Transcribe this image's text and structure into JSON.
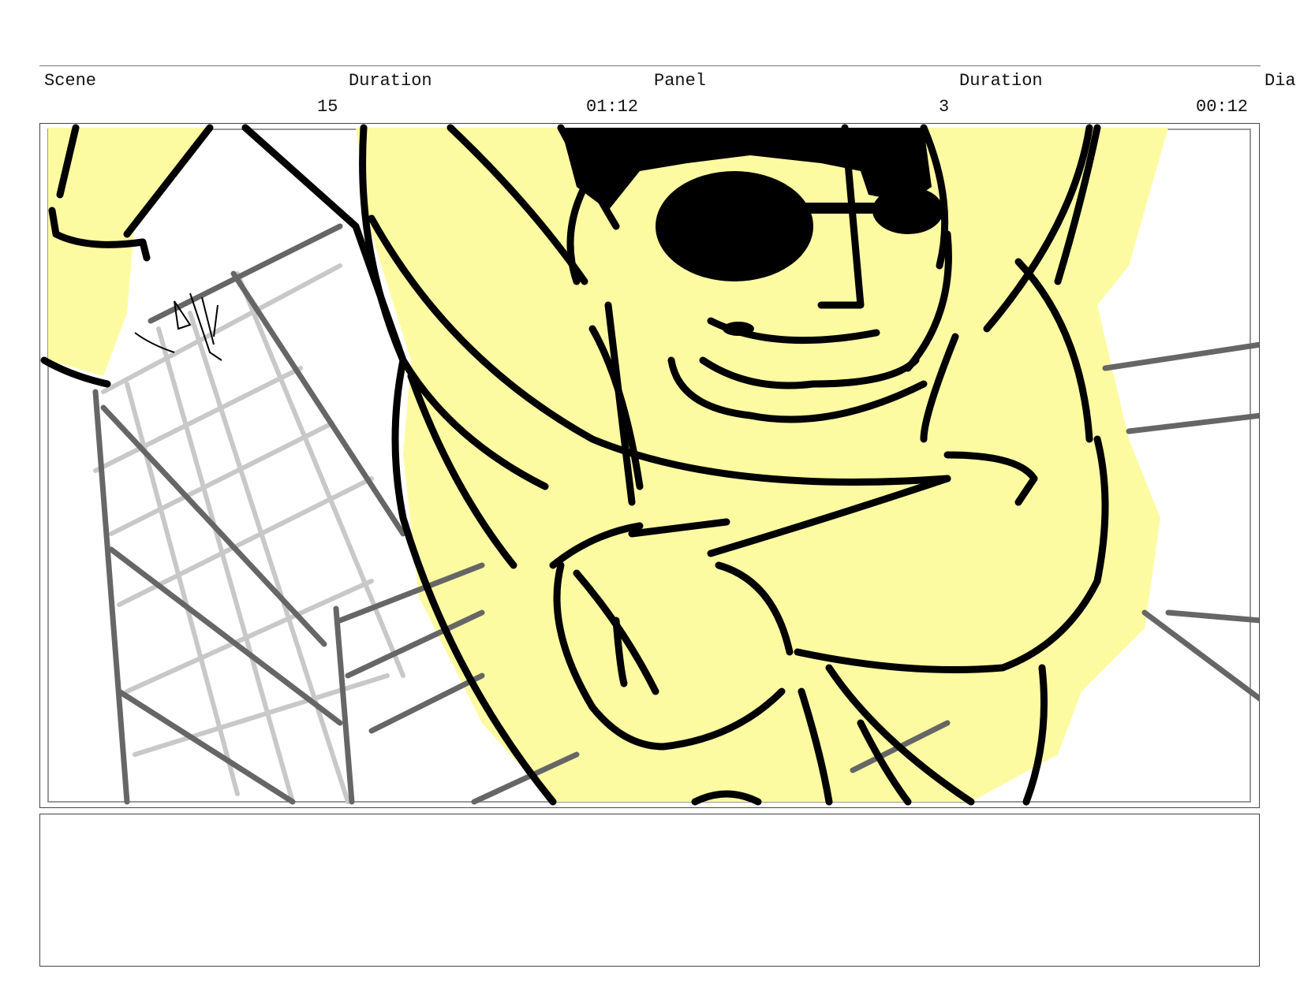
{
  "header": {
    "scene_label": "Scene",
    "scene_duration_label": "Duration",
    "panel_label": "Panel",
    "panel_duration_label": "Duration",
    "dialogue_label": "Dia"
  },
  "values": {
    "scene_number": "15",
    "scene_duration": "01:12",
    "panel_number": "3",
    "panel_duration": "00:12"
  },
  "panel_image": {
    "description_icon": "storyboard-sketch",
    "fill_color": "#FDFBA2",
    "ink_color": "#000000",
    "background_line_color": "#666666",
    "grid_line_color": "#c8c8c8"
  },
  "notes": {
    "text": ""
  }
}
